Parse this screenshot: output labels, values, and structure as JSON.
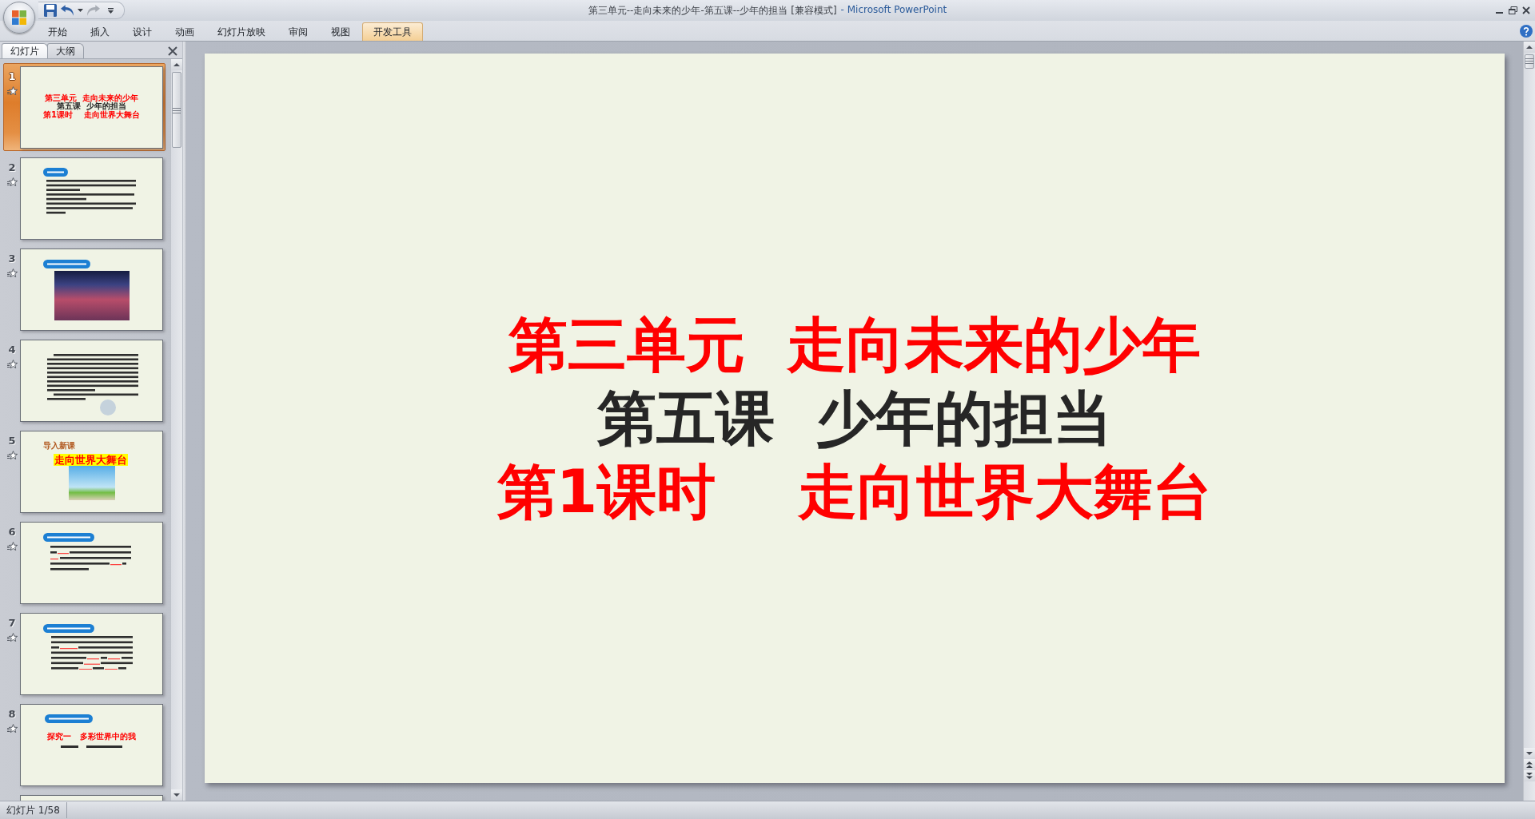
{
  "window": {
    "title": "第三单元--走向未来的少年-第五课--少年的担当 [兼容模式]",
    "app_name": "- Microsoft PowerPoint"
  },
  "quick_access": [
    {
      "kind": "save",
      "disabled": false
    },
    {
      "kind": "undo",
      "disabled": false
    },
    {
      "kind": "redo",
      "disabled": true
    },
    {
      "kind": "customize",
      "disabled": false
    }
  ],
  "ribbon_tabs": [
    {
      "label": "开始",
      "selected": false
    },
    {
      "label": "插入",
      "selected": false
    },
    {
      "label": "设计",
      "selected": false
    },
    {
      "label": "动画",
      "selected": false
    },
    {
      "label": "幻灯片放映",
      "selected": false
    },
    {
      "label": "审阅",
      "selected": false
    },
    {
      "label": "视图",
      "selected": false
    },
    {
      "label": "开发工具",
      "selected": true
    }
  ],
  "left_panel": {
    "tabs": [
      {
        "label": "幻灯片",
        "selected": true
      },
      {
        "label": "大纲",
        "selected": false
      }
    ],
    "thumbnails": [
      {
        "number": "1",
        "selected": true,
        "kind": "title",
        "lines": [
          {
            "text": "第三单元  走向未来的少年",
            "color": "#ff0000"
          },
          {
            "text": "第五课  少年的担当",
            "color": "#262626"
          },
          {
            "text": "第1课时    走向世界大舞台",
            "color": "#ff0000"
          }
        ]
      },
      {
        "number": "2",
        "selected": false,
        "kind": "objectives"
      },
      {
        "number": "3",
        "selected": false,
        "kind": "photo"
      },
      {
        "number": "4",
        "selected": false,
        "kind": "paragraph"
      },
      {
        "number": "5",
        "selected": false,
        "kind": "cover",
        "label": "导入新课",
        "banner": "走向世界大舞台"
      },
      {
        "number": "6",
        "selected": false,
        "kind": "blanks"
      },
      {
        "number": "7",
        "selected": false,
        "kind": "exercise"
      },
      {
        "number": "8",
        "selected": false,
        "kind": "section",
        "heading": "探究一   多彩世界中的我"
      },
      {
        "selected": false,
        "kind": "partial"
      }
    ]
  },
  "slide": {
    "lines": [
      {
        "text": "第三单元  走向未来的少年",
        "color": "#ff0000"
      },
      {
        "text": "第五课  少年的担当",
        "color": "#262626"
      },
      {
        "text": "第1课时    走向世界大舞台",
        "color": "#ff0000"
      }
    ]
  },
  "status_bar": {
    "slide_indicator": "幻灯片 1/58"
  }
}
